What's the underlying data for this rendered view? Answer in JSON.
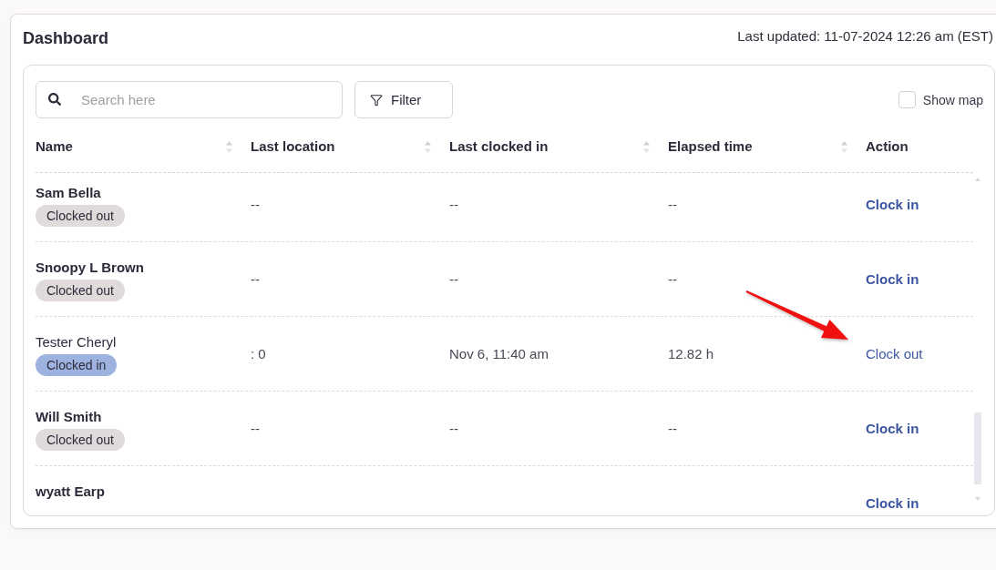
{
  "header": {
    "title": "Dashboard",
    "last_updated": "Last updated: 11-07-2024 12:26 am (EST)"
  },
  "toolbar": {
    "search": {
      "placeholder": "Search here"
    },
    "filter_button": "Filter",
    "show_map": {
      "label": "Show map",
      "checked": false
    }
  },
  "table": {
    "columns": [
      {
        "label": "Name",
        "sortable": true
      },
      {
        "label": "Last location",
        "sortable": true
      },
      {
        "label": "Last clocked in",
        "sortable": true
      },
      {
        "label": "Elapsed time",
        "sortable": true
      },
      {
        "label": "Action",
        "sortable": false
      }
    ],
    "rows": [
      {
        "name": "Sam Bella",
        "status": "Clocked out",
        "clocked_in": false,
        "last_location": "--",
        "last_clocked_in": "--",
        "elapsed_time": "--",
        "action": "Clock in"
      },
      {
        "name": "Snoopy L Brown",
        "status": "Clocked out",
        "clocked_in": false,
        "last_location": "--",
        "last_clocked_in": "--",
        "elapsed_time": "--",
        "action": "Clock in"
      },
      {
        "name": "Tester Cheryl",
        "status": "Clocked in",
        "clocked_in": true,
        "last_location": ": 0",
        "last_clocked_in": "Nov 6, 11:40 am",
        "elapsed_time": "12.82 h",
        "action": "Clock out"
      },
      {
        "name": "Will Smith",
        "status": "Clocked out",
        "clocked_in": false,
        "last_location": "--",
        "last_clocked_in": "--",
        "elapsed_time": "--",
        "action": "Clock in"
      },
      {
        "name": "wyatt Earp",
        "clocked_in": false,
        "action": "Clock in"
      }
    ]
  }
}
